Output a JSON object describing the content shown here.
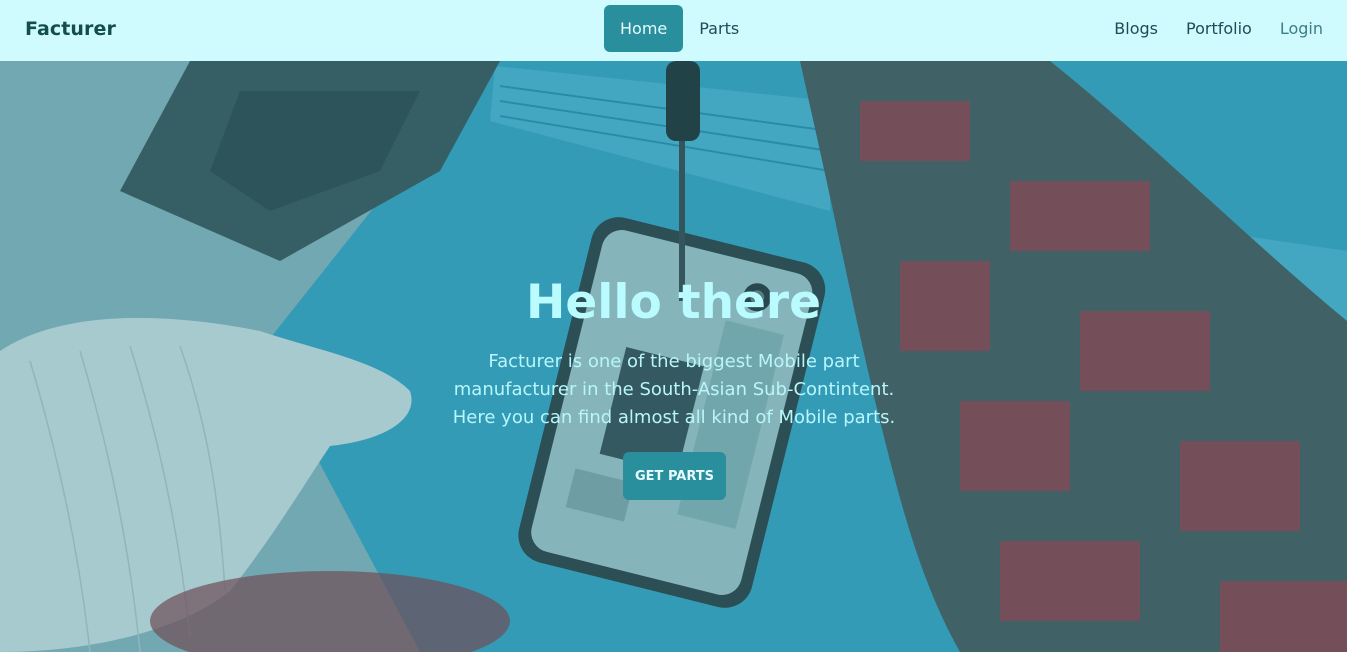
{
  "navbar": {
    "brand": "Facturer",
    "center_items": [
      {
        "label": "Home",
        "active": true
      },
      {
        "label": "Parts",
        "active": false
      }
    ],
    "right_items": [
      {
        "label": "Blogs"
      },
      {
        "label": "Portfolio"
      },
      {
        "label": "Login"
      }
    ]
  },
  "hero": {
    "title": "Hello there",
    "description": "Facturer is one of the biggest Mobile part manufacturer in the South-Asian Sub-Contintent. Here you can find almost all kind of Mobile parts.",
    "button_label": "GET PARTS"
  },
  "colors": {
    "navbar_bg": "#cffafe",
    "accent": "#2a8f9c",
    "hero_text": "#b9fbff"
  }
}
